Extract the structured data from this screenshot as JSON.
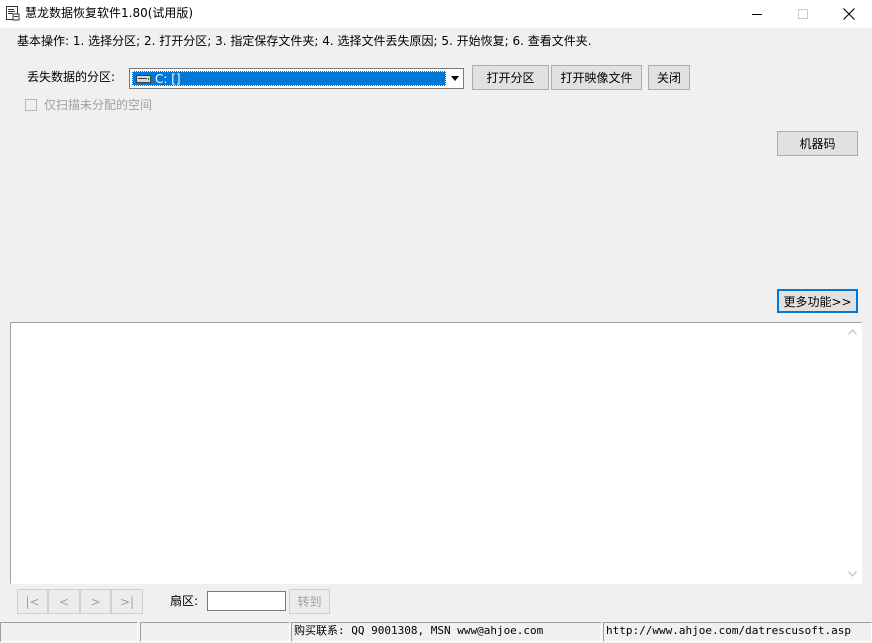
{
  "window": {
    "title": "慧龙数据恢复软件1.80(试用版)",
    "minimize_icon": "minimize-icon",
    "maximize_icon": "maximize-icon",
    "close_icon": "close-icon"
  },
  "instructions": "基本操作: 1. 选择分区; 2. 打开分区; 3. 指定保存文件夹; 4. 选择文件丢失原因; 5. 开始恢复; 6. 查看文件夹.",
  "partition": {
    "label": "丢失数据的分区:",
    "selected": "C: []",
    "drive_icon": "drive-icon"
  },
  "buttons": {
    "open_partition": "打开分区",
    "open_image": "打开映像文件",
    "close": "关闭",
    "machine_code": "机器码",
    "more_features": "更多功能>>"
  },
  "options": {
    "scan_unallocated": "仅扫描未分配的空间",
    "scan_unallocated_checked": false
  },
  "navigation": {
    "first": "|<",
    "prev": "<",
    "next": ">",
    "last": ">|",
    "sector_label": "扇区:",
    "sector_value": "",
    "goto": "转到"
  },
  "statusbar": {
    "cell1": "",
    "cell2": "",
    "contact": "购买联系: QQ 9001308, MSN www@ahjoe.com",
    "url": "http://www.ahjoe.com/datrescusoft.asp"
  },
  "colors": {
    "selection": "#0078d7",
    "window_bg": "#f0f0f0",
    "disabled_text": "#a0a0a0"
  }
}
